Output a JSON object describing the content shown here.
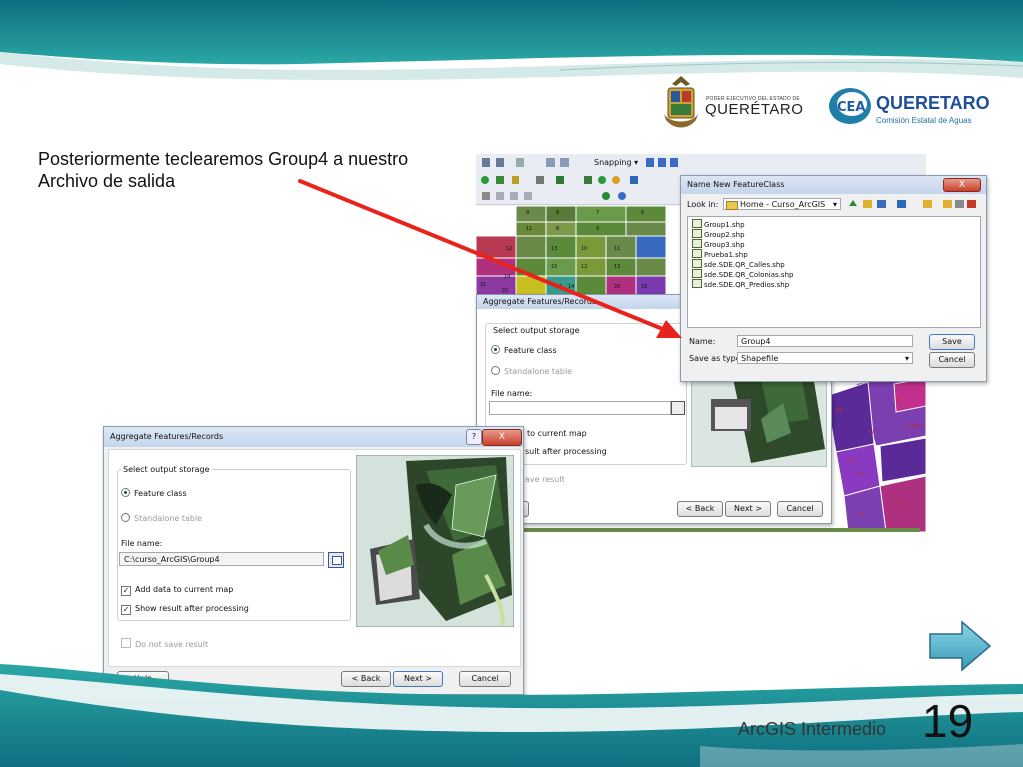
{
  "slide": {
    "caption_line1": "Posteriormente teclearemos Group4 a nuestro",
    "caption_line2": "Archivo de salida",
    "footer_title": "ArcGIS Intermedio",
    "page_number": "19"
  },
  "logos": {
    "gov_small": "PODER EJECUTIVO DEL ESTADO DE",
    "gov_name": "QUERÉTARO",
    "cea_mark": "CEA",
    "cea_name": "QUERETARO",
    "cea_sub": "Comisión Estatal de Aguas"
  },
  "toolbar": {
    "snapping_label": "Snapping ▾"
  },
  "map_labels": [
    "9",
    "8",
    "7",
    "6",
    "11",
    "8",
    "9",
    "12",
    "13",
    "10",
    "11",
    "15",
    "12",
    "13",
    "14",
    "21",
    "22",
    "16",
    "14",
    "20",
    "18",
    "57",
    "13",
    "B",
    "25",
    "20",
    "B1",
    "P INT B",
    "17"
  ],
  "bg_dialog": {
    "title": "Aggregate Features/Records",
    "group_label": "Select output storage",
    "feature_class": "Feature class",
    "standalone_table": "Standalone table",
    "file_name_label": "File name:",
    "file_name_value": "",
    "add_partial": "to current map",
    "show_partial": "sult after processing",
    "save_partial": "ave result",
    "back": "< Back",
    "next": "Next >",
    "cancel": "Cancel"
  },
  "save_dialog": {
    "title": "Name New FeatureClass",
    "look_in_label": "Look in:",
    "look_in_value": "Home - Curso_ArcGIS",
    "files": [
      "Group1.shp",
      "Group2.shp",
      "Group3.shp",
      "Prueba1.shp",
      "sde.SDE.QR_Calles.shp",
      "sde.SDE.QR_Colonias.shp",
      "sde.SDE.QR_Predios.shp"
    ],
    "name_label": "Name:",
    "name_value": "Group4",
    "type_label": "Save as type:",
    "type_value": "Shapefile",
    "save": "Save",
    "cancel": "Cancel",
    "close": "X"
  },
  "fg_dialog": {
    "title": "Aggregate Features/Records",
    "help_glyph": "?",
    "close": "X",
    "group_label": "Select output storage",
    "feature_class": "Feature class",
    "standalone_table": "Standalone table",
    "file_name_label": "File name:",
    "file_name_value": "C:\\curso_ArcGIS\\Group4",
    "add_to_map": "Add data to current map",
    "show_result": "Show result after processing",
    "do_not_save": "Do not save result",
    "help": "Help",
    "back": "< Back",
    "next": "Next >",
    "cancel": "Cancel"
  },
  "colors": {
    "teal": "#1d8a96",
    "arrow_red": "#e8231c",
    "map_purple": "#7b3fb0",
    "map_magenta": "#c0308c",
    "map_green": "#5d8a3a"
  }
}
